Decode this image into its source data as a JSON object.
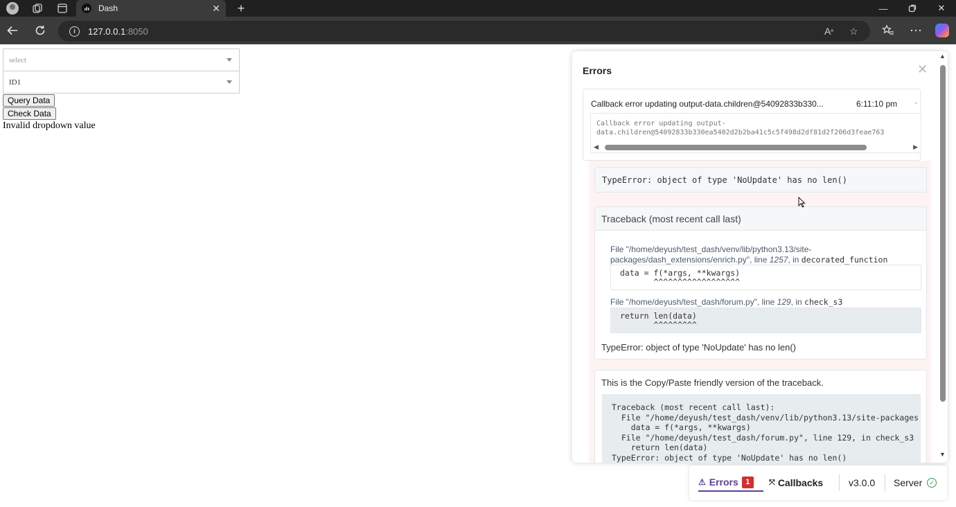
{
  "browser": {
    "tab_title": "Dash",
    "tab_favicon": "chart-icon",
    "url_host": "127.0.0.1",
    "url_port": ":8050"
  },
  "page": {
    "dropdown1_placeholder": "select",
    "dropdown2_value": "ID1",
    "query_button": "Query Data",
    "check_button": "Check Data",
    "message": "Invalid dropdown value"
  },
  "errors_panel": {
    "title": "Errors",
    "item_header": "Callback error updating output-data.children@54092833b330...",
    "item_time": "6:11:10 pm",
    "item_pre": "Callback error updating output-\ndata.children@54092833b330ea5402d2b2ba41c5c5f498d2df81d2f206d3feae763",
    "type_error": "TypeError: object of type 'NoUpdate' has no len()",
    "traceback_title": "Traceback (most recent call last)",
    "frame1_file": "File \"/home/deyush/test_dash/venv/lib/python3.13/site-packages/dash_extensions/enrich.py\", line ",
    "frame1_lineno": "1257",
    "frame1_in": ", in ",
    "frame1_func": "decorated_function",
    "frame1_code": "data = f(*args, **kwargs)\n       ^^^^^^^^^^^^^^^^^^",
    "frame2_file": "File \"/home/deyush/test_dash/forum.py\", line ",
    "frame2_lineno": "129",
    "frame2_in": ", in ",
    "frame2_func": "check_s3",
    "frame2_code": "return len(data)\n       ^^^^^^^^^",
    "traceback_footer": "TypeError: object of type 'NoUpdate' has no len()",
    "copy_title": "This is the Copy/Paste friendly version of the traceback.",
    "copy_text": "Traceback (most recent call last):\n  File \"/home/deyush/test_dash/venv/lib/python3.13/site-packages\n    data = f(*args, **kwargs)\n  File \"/home/deyush/test_dash/forum.py\", line 129, in check_s3\n    return len(data)\nTypeError: object of type 'NoUpdate' has no len()"
  },
  "devtools": {
    "errors_label": "Errors",
    "errors_count": "1",
    "callbacks_label": "Callbacks",
    "version": "v3.0.0",
    "server_label": "Server"
  }
}
